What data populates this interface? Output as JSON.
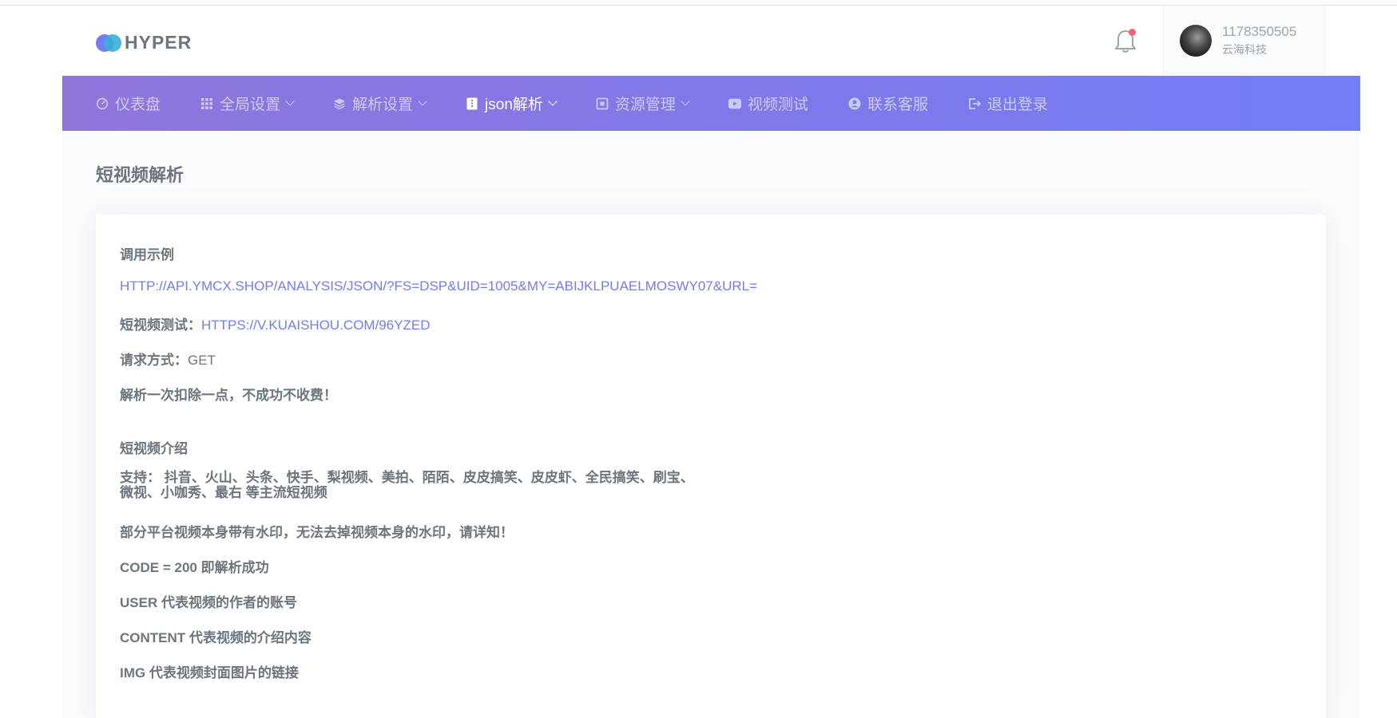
{
  "brand": {
    "name": "HYPER"
  },
  "user": {
    "name": "1178350505",
    "org": "云海科技"
  },
  "nav": {
    "items": [
      {
        "label": "仪表盘"
      },
      {
        "label": "全局设置"
      },
      {
        "label": "解析设置"
      },
      {
        "label": "json解析"
      },
      {
        "label": "资源管理"
      },
      {
        "label": "视频测试"
      },
      {
        "label": "联系客服"
      },
      {
        "label": "退出登录"
      }
    ]
  },
  "page": {
    "title": "短视频解析"
  },
  "content": {
    "example_heading": "调用示例",
    "api_url": "HTTP://API.YMCX.SHOP/ANALYSIS/JSON/?FS=DSP&UID=1005&MY=ABIJKLPUAELMOSWY07&URL=",
    "test_label": "短视频测试：",
    "test_url": "HTTPS://V.KUAISHOU.COM/96YZED",
    "method_label": "请求方式：",
    "method_value": "GET",
    "fee_note": "解析一次扣除一点，不成功不收费！",
    "intro_heading": "短视频介绍",
    "support_line1": "支持： 抖音、火山、头条、快手、梨视频、美拍、陌陌、皮皮搞笑、皮皮虾、全民搞笑、刷宝、",
    "support_line2": "微视、小咖秀、最右 等主流短视频",
    "watermark_note": "部分平台视频本身带有水印，无法去掉视频本身的水印，请详知！",
    "code_note": "CODE = 200 即解析成功",
    "user_note": "USER 代表视频的作者的账号",
    "content_note": "CONTENT 代表视频的介绍内容",
    "img_note": "IMG 代表视频封面图片的链接"
  },
  "colors": {
    "accent": "#727cf5",
    "nav_gradient_start": "#8f75da",
    "nav_gradient_end": "#727cf5",
    "notification_dot": "#fa5c7c"
  }
}
